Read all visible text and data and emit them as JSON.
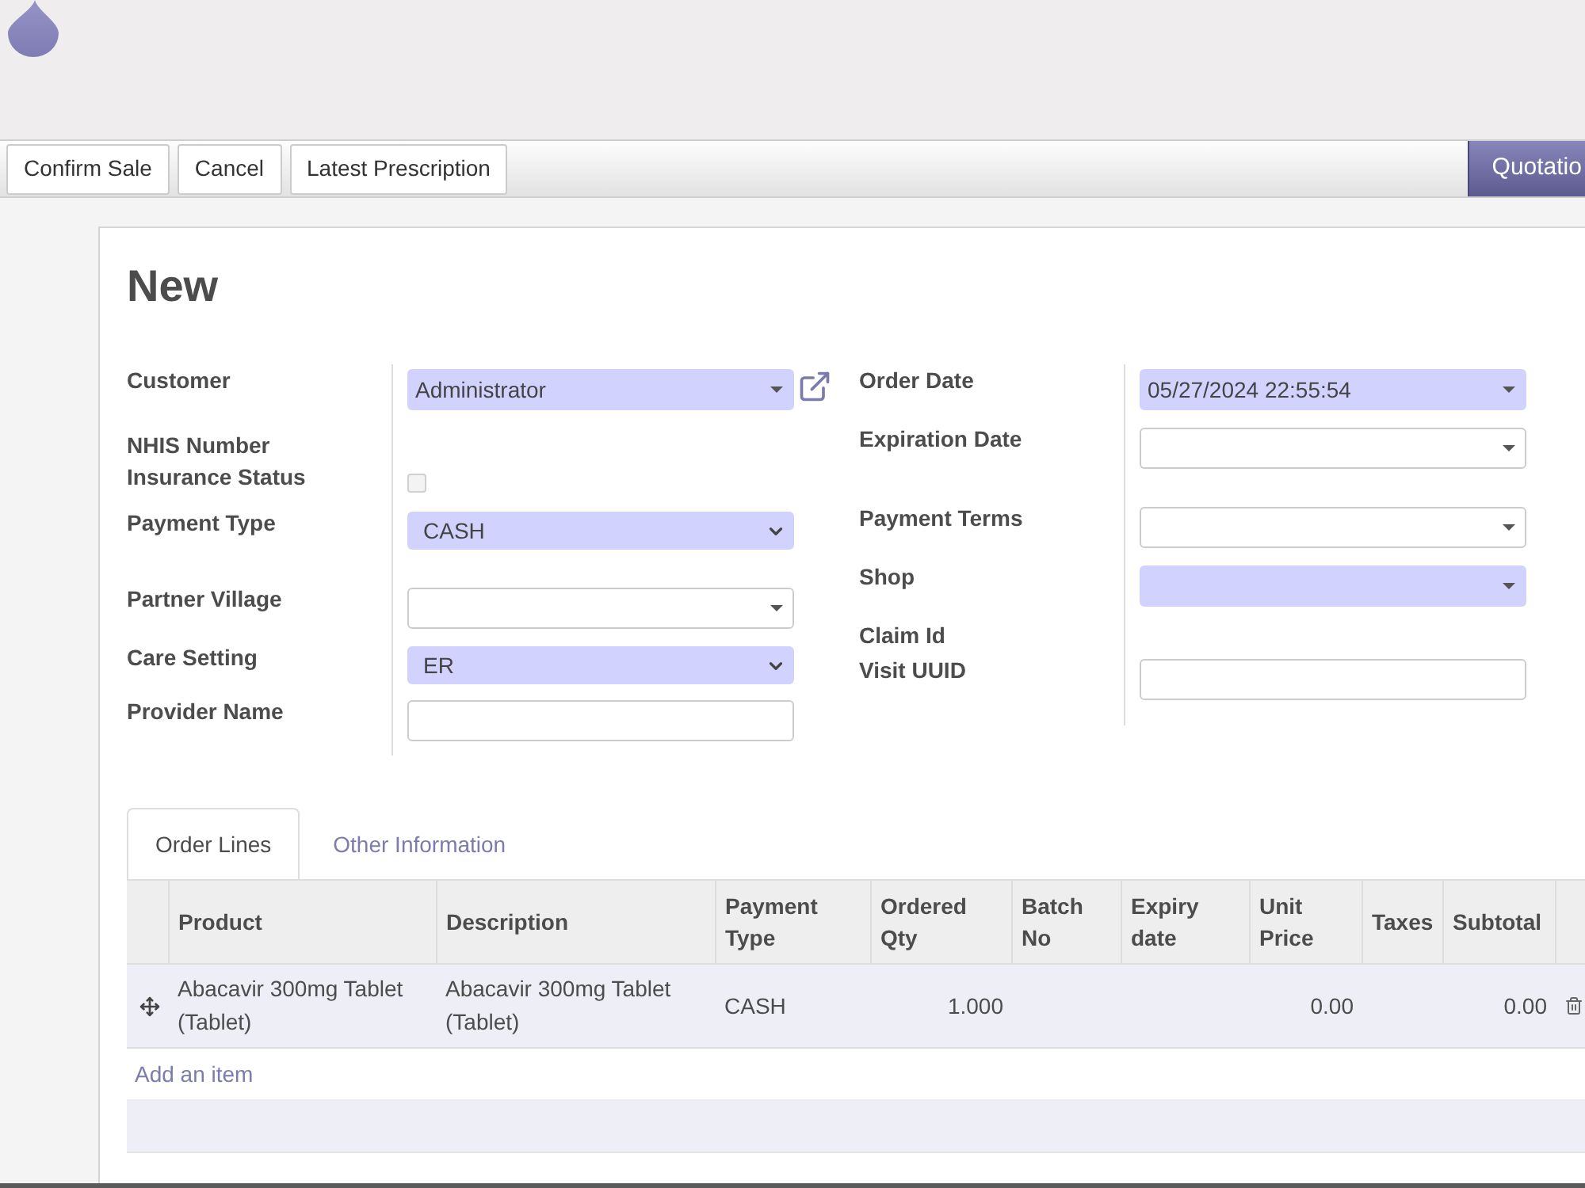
{
  "toolbar": {
    "buttons": [
      "Confirm Sale",
      "Cancel",
      "Latest Prescription"
    ],
    "stages": [
      {
        "label": "Quotatio",
        "selected": true
      }
    ]
  },
  "form": {
    "title": "New",
    "left_fields": [
      {
        "label": "Customer",
        "kind": "dropdown",
        "value": "Administrator",
        "required": true,
        "open_link": true
      },
      {
        "label": "NHIS Number",
        "kind": "none",
        "open_link": false
      },
      {
        "label": "Insurance Status",
        "kind": "checkbox",
        "checked": false,
        "required": false,
        "open_link": false
      },
      {
        "label": "Payment Type",
        "kind": "select",
        "value": "CASH",
        "required": true,
        "open_link": false
      },
      {
        "label": "Partner Village",
        "kind": "dropdown",
        "required": false,
        "open_link": false
      },
      {
        "label": "Care Setting",
        "kind": "select",
        "value": "ER",
        "required": true,
        "open_link": false
      },
      {
        "label": "Provider Name",
        "kind": "text",
        "required": false,
        "open_link": false
      }
    ],
    "right_fields": [
      {
        "label": "Order Date",
        "kind": "dropdown",
        "value": "05/27/2024 22:55:54",
        "required": true,
        "open_link": false
      },
      {
        "label": "Expiration Date",
        "kind": "dropdown",
        "required": false,
        "open_link": false
      },
      {
        "label": "Payment Terms",
        "kind": "dropdown",
        "required": false,
        "open_link": false
      },
      {
        "label": "Shop",
        "kind": "dropdown",
        "required": true,
        "open_link": false
      },
      {
        "label": "Claim Id",
        "kind": "none",
        "open_link": false
      },
      {
        "label": "Visit UUID",
        "kind": "text",
        "required": false,
        "open_link": false
      }
    ]
  },
  "notebook": {
    "tabs": [
      {
        "label": "Order Lines",
        "selected": true
      },
      {
        "label": "Other Information",
        "selected": false
      }
    ],
    "order_lines": {
      "columns": [
        {
          "label": "Product",
          "kind": "text"
        },
        {
          "label": "Description",
          "kind": "text"
        },
        {
          "label": "Payment Type",
          "kind": "text"
        },
        {
          "label": "Ordered Qty",
          "kind": "number"
        },
        {
          "label": "Batch No",
          "kind": "text"
        },
        {
          "label": "Expiry date",
          "kind": "text"
        },
        {
          "label": "Unit Price",
          "kind": "number"
        },
        {
          "label": "Taxes",
          "kind": "text"
        },
        {
          "label": "Subtotal",
          "kind": "number"
        }
      ],
      "rows": [
        {
          "cells": [
            "Abacavir 300mg Tablet (Tablet)",
            "Abacavir 300mg Tablet (Tablet)",
            "CASH",
            "1.000",
            null,
            null,
            "0.00",
            null,
            "0.00"
          ]
        }
      ],
      "add_item": "Add an item"
    }
  }
}
